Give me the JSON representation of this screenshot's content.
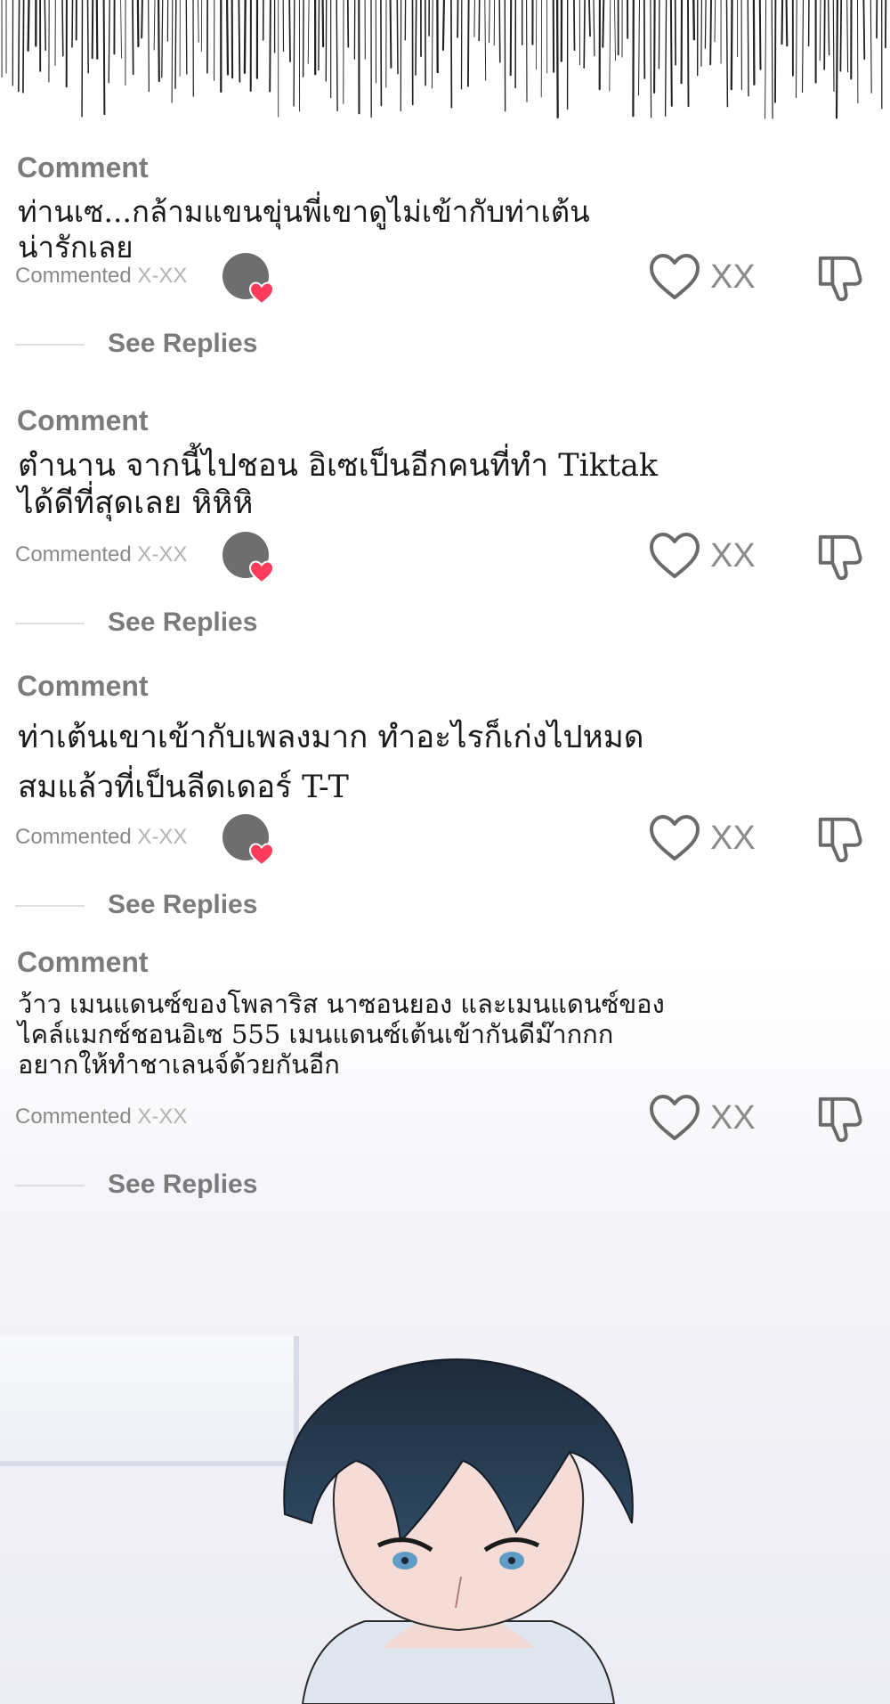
{
  "comments": [
    {
      "label": "Comment",
      "text": "ท่านเซ...กล้ามแขนขุ่นพี่เขาดูไม่เข้ากับท่าเต้น\nน่ารักเลย",
      "meta_prefix": "Commented ",
      "meta_value": "X-XX",
      "likes": "XX",
      "replies": "See Replies"
    },
    {
      "label": "Comment",
      "text": "ตำนาน จากนี้ไปชอน อิเซเป็นอีกคนที่ทำ Tiktak\nได้ดีที่สุดเลย หิหิหิ",
      "meta_prefix": "Commented ",
      "meta_value": "X-XX",
      "likes": "XX",
      "replies": "See Replies"
    },
    {
      "label": "Comment",
      "text": "ท่าเต้นเขาเข้ากับเพลงมาก ทำอะไรก็เก่งไปหมด\nสมแล้วที่เป็นลีดเดอร์ T-T",
      "meta_prefix": "Commented ",
      "meta_value": "X-XX",
      "likes": "XX",
      "replies": "See Replies"
    },
    {
      "label": "Comment",
      "text": "ว้าว เมนแดนซ์ของโพลาริส นาซอนยอง และเมนแดนซ์ของ\nไคล์แมกซ์ชอนอิเซ 555 เมนแดนซ์เต้นเข้ากันดีม๊ากกก\nอยากให้ทำชาเลนจ์ด้วยกันอีก",
      "meta_prefix": "Commented ",
      "meta_value": "X-XX",
      "likes": "XX",
      "replies": "See Replies"
    }
  ],
  "icons": {
    "avatar": "avatar-icon",
    "badge": "heart-badge-icon",
    "like": "heart-outline-icon",
    "dislike": "thumbs-down-icon"
  },
  "colors": {
    "label": "#7b7b7b",
    "text": "#1a1a1a",
    "badge": "#ff3b5c",
    "avatar": "#6e6e6e",
    "icon": "#6a6a6a"
  }
}
